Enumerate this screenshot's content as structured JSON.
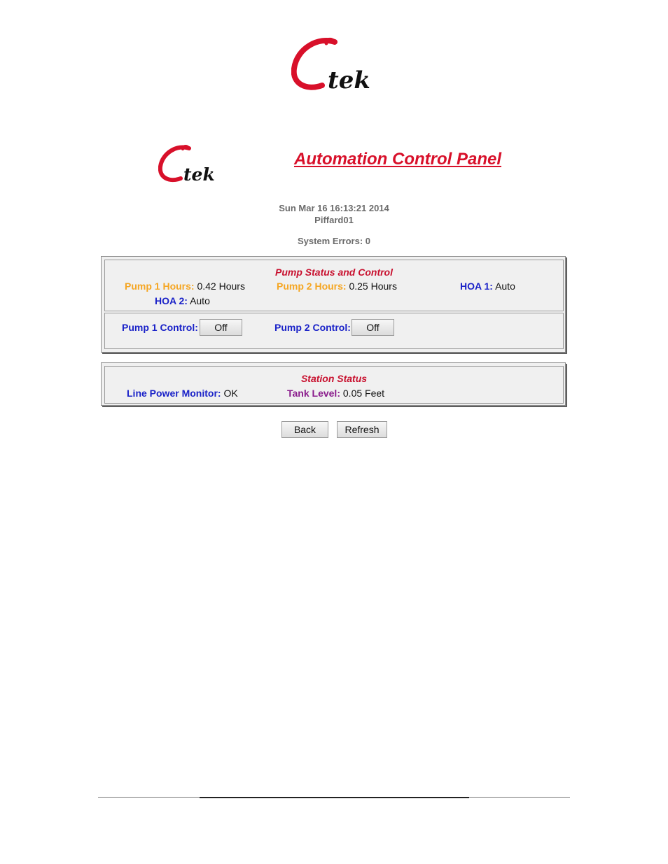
{
  "brand": {
    "logo_text": "Ctek",
    "logo_color": "#d8102a"
  },
  "header": {
    "title": "Automation Control Panel"
  },
  "info": {
    "datetime": "Sun Mar 16 16:13:21 2014",
    "station_name": "Piffard01",
    "system_errors_label": "System Errors:",
    "system_errors_value": "0"
  },
  "pump_section": {
    "title": "Pump Status and Control",
    "pump1_hours_label": "Pump 1 Hours:",
    "pump1_hours_value": "0.42 Hours",
    "pump2_hours_label": "Pump 2 Hours:",
    "pump2_hours_value": "0.25 Hours",
    "hoa1_label": "HOA 1:",
    "hoa1_value": "Auto",
    "hoa2_label": "HOA 2:",
    "hoa2_value": "Auto",
    "pump1_control_label": "Pump 1 Control:",
    "pump1_control_button": "Off",
    "pump2_control_label": "Pump 2 Control:",
    "pump2_control_button": "Off"
  },
  "station_section": {
    "title": "Station Status",
    "line_power_label": "Line Power Monitor:",
    "line_power_value": "OK",
    "tank_level_label": "Tank Level:",
    "tank_level_value": "0.05 Feet"
  },
  "actions": {
    "back_label": "Back",
    "refresh_label": "Refresh"
  },
  "colors": {
    "title_red": "#d8102a",
    "label_orange": "#f5a623",
    "label_blue": "#1a22c8",
    "label_purple": "#8a1c8c",
    "panel_background": "#f0f0f0"
  }
}
